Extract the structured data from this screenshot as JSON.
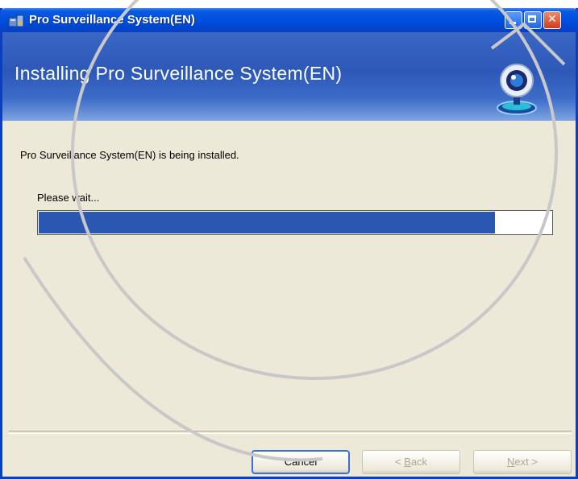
{
  "window": {
    "title": "Pro Surveillance System(EN)",
    "icons": {
      "app": "installer-icon",
      "minimize": "minimize-icon",
      "maximize": "maximize-icon",
      "close": "close-icon"
    }
  },
  "banner": {
    "heading": "Installing Pro Surveillance System(EN)",
    "logo_icon": "webcam-icon"
  },
  "content": {
    "status": "Pro Surveillance System(EN) is being installed.",
    "wait_label": "Please wait...",
    "progress_fraction": 0.89
  },
  "buttons": {
    "cancel": "Cancel",
    "back_prefix": "< ",
    "back_key": "B",
    "back_rest": "ack",
    "next_key": "N",
    "next_rest": "ext >",
    "back_enabled": false,
    "next_enabled": false
  },
  "colors": {
    "titlebar": "#0050e0",
    "banner": "#2d58b8",
    "progress_fill": "#2a57b0",
    "dialog_bg": "#ece9d8"
  }
}
